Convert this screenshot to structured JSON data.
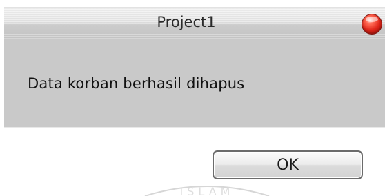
{
  "window": {
    "title": "Project1"
  },
  "dialog": {
    "message": "Data korban berhasil dihapus",
    "ok_label": "OK"
  },
  "colors": {
    "body_background": "#c9c9c9",
    "close_button": "#e0261a"
  },
  "icons": {
    "close": "close-orb-icon"
  },
  "watermark": "ISLAM"
}
